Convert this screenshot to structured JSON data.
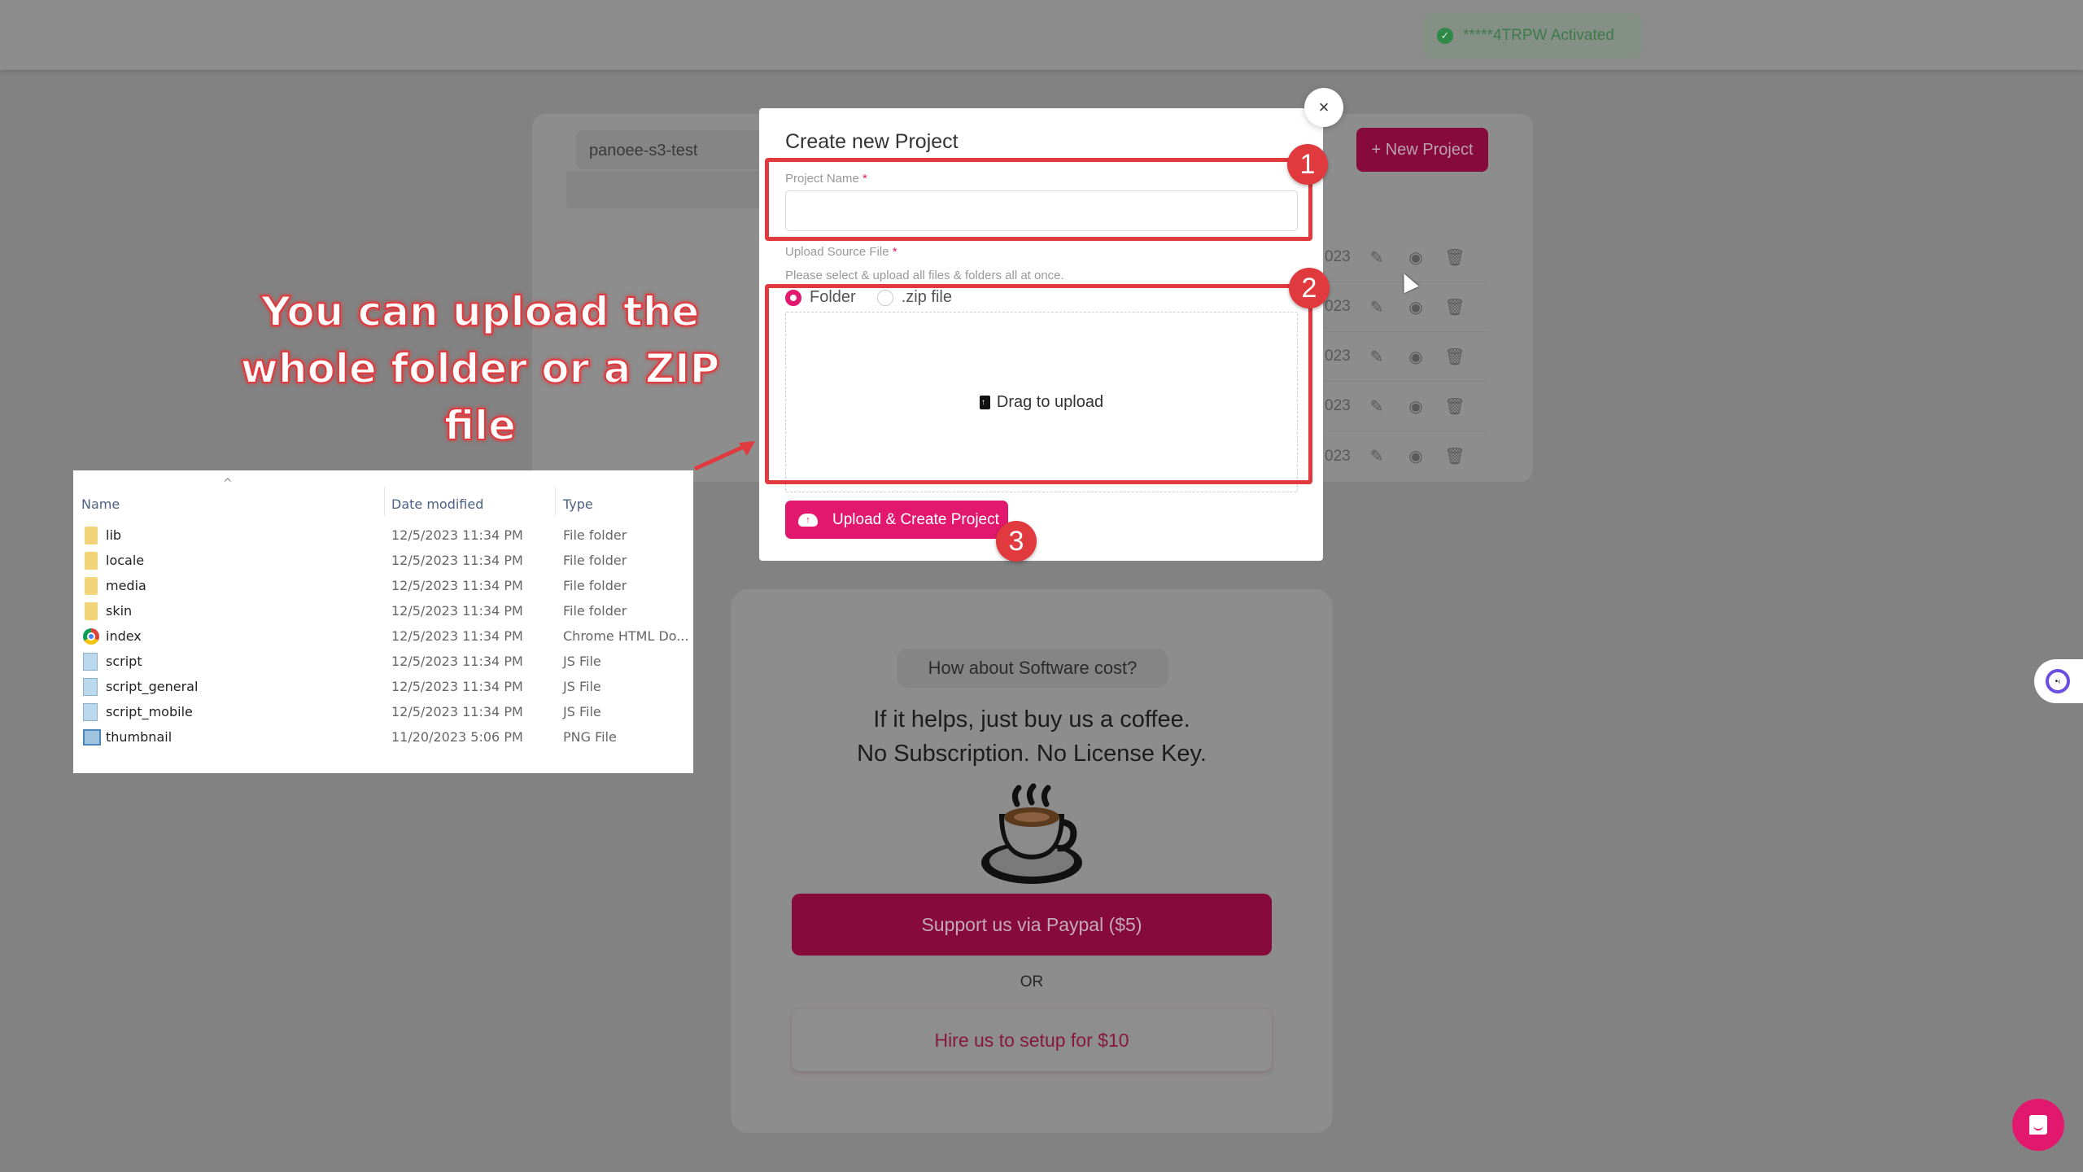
{
  "topbar": {
    "license_badge": "*****4TRPW Activated",
    "license_icon": "check-circle-icon"
  },
  "background_panel": {
    "bucket_select": "panoee-s3-test",
    "new_project_button": "+ New Project",
    "rows": [
      {
        "date_fragment": "023"
      },
      {
        "date_fragment": "023"
      },
      {
        "date_fragment": "023"
      },
      {
        "date_fragment": "023"
      },
      {
        "date_fragment": "023"
      }
    ],
    "row_actions": [
      "pencil-icon",
      "eye-icon",
      "trash-icon"
    ]
  },
  "modal": {
    "title": "Create new Project",
    "close_label": "×",
    "project_name_label": "Project Name",
    "project_name_value": "",
    "required_marker": "*",
    "upload_source_label": "Upload Source File",
    "upload_hint": "Please select & upload all files & folders all at once.",
    "radio_options": [
      {
        "label": "Folder",
        "selected": true
      },
      {
        "label": ".zip file",
        "selected": false
      }
    ],
    "dropzone_text": "Drag to upload",
    "submit_button": "Upload & Create Project"
  },
  "annotations": {
    "callout_line1": "You can upload the",
    "callout_line2": "whole folder or a ZIP file",
    "step_numbers": [
      "1",
      "2",
      "3"
    ],
    "accent_color": "#e0393e"
  },
  "explorer": {
    "columns": [
      "Name",
      "Date modified",
      "Type"
    ],
    "sort_indicator": "^",
    "files": [
      {
        "name": "lib",
        "date": "12/5/2023 11:34 PM",
        "type": "File folder",
        "icon": "folder-icon"
      },
      {
        "name": "locale",
        "date": "12/5/2023 11:34 PM",
        "type": "File folder",
        "icon": "folder-icon"
      },
      {
        "name": "media",
        "date": "12/5/2023 11:34 PM",
        "type": "File folder",
        "icon": "folder-icon"
      },
      {
        "name": "skin",
        "date": "12/5/2023 11:34 PM",
        "type": "File folder",
        "icon": "folder-icon"
      },
      {
        "name": "index",
        "date": "12/5/2023 11:34 PM",
        "type": "Chrome HTML Do...",
        "icon": "chrome-icon"
      },
      {
        "name": "script",
        "date": "12/5/2023 11:34 PM",
        "type": "JS File",
        "icon": "js-file-icon"
      },
      {
        "name": "script_general",
        "date": "12/5/2023 11:34 PM",
        "type": "JS File",
        "icon": "js-file-icon"
      },
      {
        "name": "script_mobile",
        "date": "12/5/2023 11:34 PM",
        "type": "JS File",
        "icon": "js-file-icon"
      },
      {
        "name": "thumbnail",
        "date": "11/20/2023 5:06 PM",
        "type": "PNG File",
        "icon": "png-file-icon"
      }
    ]
  },
  "coffee_card": {
    "pill": "How about Software cost?",
    "line1": "If it helps, just buy us a coffee.",
    "line2": "No Subscription. No License Key.",
    "paypal_button": "Support us via Paypal ($5)",
    "or_text": "OR",
    "hire_button": "Hire us to setup for $10"
  },
  "colors": {
    "brand_pink": "#e2186e",
    "dimmed_brand": "#870a3c",
    "overlay": "#828282"
  }
}
